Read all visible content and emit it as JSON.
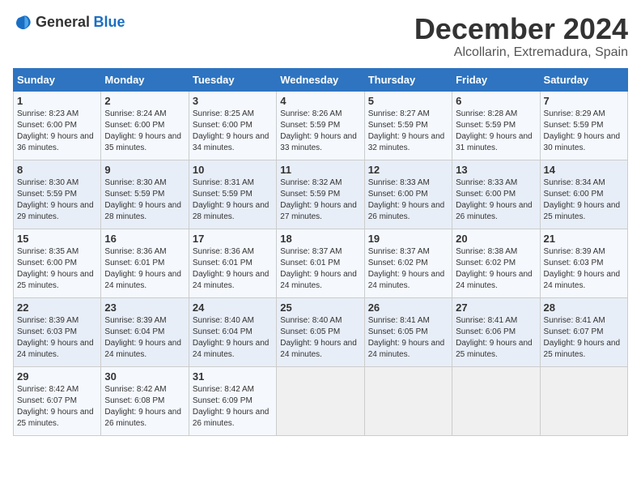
{
  "logo": {
    "text_general": "General",
    "text_blue": "Blue"
  },
  "title": {
    "month": "December 2024",
    "location": "Alcollarin, Extremadura, Spain"
  },
  "calendar": {
    "headers": [
      "Sunday",
      "Monday",
      "Tuesday",
      "Wednesday",
      "Thursday",
      "Friday",
      "Saturday"
    ],
    "weeks": [
      [
        {
          "day": "1",
          "sunrise": "Sunrise: 8:23 AM",
          "sunset": "Sunset: 6:00 PM",
          "daylight": "Daylight: 9 hours and 36 minutes."
        },
        {
          "day": "2",
          "sunrise": "Sunrise: 8:24 AM",
          "sunset": "Sunset: 6:00 PM",
          "daylight": "Daylight: 9 hours and 35 minutes."
        },
        {
          "day": "3",
          "sunrise": "Sunrise: 8:25 AM",
          "sunset": "Sunset: 6:00 PM",
          "daylight": "Daylight: 9 hours and 34 minutes."
        },
        {
          "day": "4",
          "sunrise": "Sunrise: 8:26 AM",
          "sunset": "Sunset: 5:59 PM",
          "daylight": "Daylight: 9 hours and 33 minutes."
        },
        {
          "day": "5",
          "sunrise": "Sunrise: 8:27 AM",
          "sunset": "Sunset: 5:59 PM",
          "daylight": "Daylight: 9 hours and 32 minutes."
        },
        {
          "day": "6",
          "sunrise": "Sunrise: 8:28 AM",
          "sunset": "Sunset: 5:59 PM",
          "daylight": "Daylight: 9 hours and 31 minutes."
        },
        {
          "day": "7",
          "sunrise": "Sunrise: 8:29 AM",
          "sunset": "Sunset: 5:59 PM",
          "daylight": "Daylight: 9 hours and 30 minutes."
        }
      ],
      [
        {
          "day": "8",
          "sunrise": "Sunrise: 8:30 AM",
          "sunset": "Sunset: 5:59 PM",
          "daylight": "Daylight: 9 hours and 29 minutes."
        },
        {
          "day": "9",
          "sunrise": "Sunrise: 8:30 AM",
          "sunset": "Sunset: 5:59 PM",
          "daylight": "Daylight: 9 hours and 28 minutes."
        },
        {
          "day": "10",
          "sunrise": "Sunrise: 8:31 AM",
          "sunset": "Sunset: 5:59 PM",
          "daylight": "Daylight: 9 hours and 28 minutes."
        },
        {
          "day": "11",
          "sunrise": "Sunrise: 8:32 AM",
          "sunset": "Sunset: 5:59 PM",
          "daylight": "Daylight: 9 hours and 27 minutes."
        },
        {
          "day": "12",
          "sunrise": "Sunrise: 8:33 AM",
          "sunset": "Sunset: 6:00 PM",
          "daylight": "Daylight: 9 hours and 26 minutes."
        },
        {
          "day": "13",
          "sunrise": "Sunrise: 8:33 AM",
          "sunset": "Sunset: 6:00 PM",
          "daylight": "Daylight: 9 hours and 26 minutes."
        },
        {
          "day": "14",
          "sunrise": "Sunrise: 8:34 AM",
          "sunset": "Sunset: 6:00 PM",
          "daylight": "Daylight: 9 hours and 25 minutes."
        }
      ],
      [
        {
          "day": "15",
          "sunrise": "Sunrise: 8:35 AM",
          "sunset": "Sunset: 6:00 PM",
          "daylight": "Daylight: 9 hours and 25 minutes."
        },
        {
          "day": "16",
          "sunrise": "Sunrise: 8:36 AM",
          "sunset": "Sunset: 6:01 PM",
          "daylight": "Daylight: 9 hours and 24 minutes."
        },
        {
          "day": "17",
          "sunrise": "Sunrise: 8:36 AM",
          "sunset": "Sunset: 6:01 PM",
          "daylight": "Daylight: 9 hours and 24 minutes."
        },
        {
          "day": "18",
          "sunrise": "Sunrise: 8:37 AM",
          "sunset": "Sunset: 6:01 PM",
          "daylight": "Daylight: 9 hours and 24 minutes."
        },
        {
          "day": "19",
          "sunrise": "Sunrise: 8:37 AM",
          "sunset": "Sunset: 6:02 PM",
          "daylight": "Daylight: 9 hours and 24 minutes."
        },
        {
          "day": "20",
          "sunrise": "Sunrise: 8:38 AM",
          "sunset": "Sunset: 6:02 PM",
          "daylight": "Daylight: 9 hours and 24 minutes."
        },
        {
          "day": "21",
          "sunrise": "Sunrise: 8:39 AM",
          "sunset": "Sunset: 6:03 PM",
          "daylight": "Daylight: 9 hours and 24 minutes."
        }
      ],
      [
        {
          "day": "22",
          "sunrise": "Sunrise: 8:39 AM",
          "sunset": "Sunset: 6:03 PM",
          "daylight": "Daylight: 9 hours and 24 minutes."
        },
        {
          "day": "23",
          "sunrise": "Sunrise: 8:39 AM",
          "sunset": "Sunset: 6:04 PM",
          "daylight": "Daylight: 9 hours and 24 minutes."
        },
        {
          "day": "24",
          "sunrise": "Sunrise: 8:40 AM",
          "sunset": "Sunset: 6:04 PM",
          "daylight": "Daylight: 9 hours and 24 minutes."
        },
        {
          "day": "25",
          "sunrise": "Sunrise: 8:40 AM",
          "sunset": "Sunset: 6:05 PM",
          "daylight": "Daylight: 9 hours and 24 minutes."
        },
        {
          "day": "26",
          "sunrise": "Sunrise: 8:41 AM",
          "sunset": "Sunset: 6:05 PM",
          "daylight": "Daylight: 9 hours and 24 minutes."
        },
        {
          "day": "27",
          "sunrise": "Sunrise: 8:41 AM",
          "sunset": "Sunset: 6:06 PM",
          "daylight": "Daylight: 9 hours and 25 minutes."
        },
        {
          "day": "28",
          "sunrise": "Sunrise: 8:41 AM",
          "sunset": "Sunset: 6:07 PM",
          "daylight": "Daylight: 9 hours and 25 minutes."
        }
      ],
      [
        {
          "day": "29",
          "sunrise": "Sunrise: 8:42 AM",
          "sunset": "Sunset: 6:07 PM",
          "daylight": "Daylight: 9 hours and 25 minutes."
        },
        {
          "day": "30",
          "sunrise": "Sunrise: 8:42 AM",
          "sunset": "Sunset: 6:08 PM",
          "daylight": "Daylight: 9 hours and 26 minutes."
        },
        {
          "day": "31",
          "sunrise": "Sunrise: 8:42 AM",
          "sunset": "Sunset: 6:09 PM",
          "daylight": "Daylight: 9 hours and 26 minutes."
        },
        null,
        null,
        null,
        null
      ]
    ]
  }
}
